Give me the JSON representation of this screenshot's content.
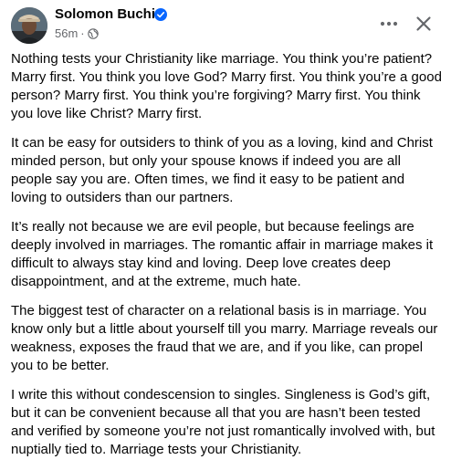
{
  "post": {
    "author": "Solomon Buchi",
    "verified": true,
    "timestamp": "56m",
    "separator": "·",
    "audience_icon": "globe-icon",
    "more_icon": "more-horizontal-icon",
    "close_icon": "close-icon",
    "paragraphs": [
      "Nothing tests your Christianity like marriage. You think you’re patient? Marry first. You think you love God? Marry first. You think you’re a good person? Marry first. You think you’re forgiving? Marry first. You think you love like Christ? Marry first.",
      "It can be easy for outsiders to think of you as a loving, kind and Christ minded person, but only your spouse knows if indeed you are all people say you are. Often times, we find it easy to be patient and loving to outsiders than our partners.",
      "It’s really not because we are evil people, but because feelings are deeply involved in marriages. The romantic affair in marriage makes it difficult to always stay kind and loving. Deep love creates deep disappointment, and at the extreme, much hate.",
      "The biggest test of character on a relational basis is in marriage. You know only but a little about yourself till you marry. Marriage reveals our weakness, exposes the fraud that we are, and if you like, can propel you to be better.",
      "I write this without condescension to singles. Singleness is God’s gift, but it can be convenient because all that you are hasn’t been tested and verified by someone you’re not just romantically involved with, but nuptially tied to. Marriage tests your Christianity."
    ]
  },
  "colors": {
    "text": "#050505",
    "secondary_text": "#65676b",
    "verified_badge": "#0866ff",
    "background": "#ffffff"
  }
}
